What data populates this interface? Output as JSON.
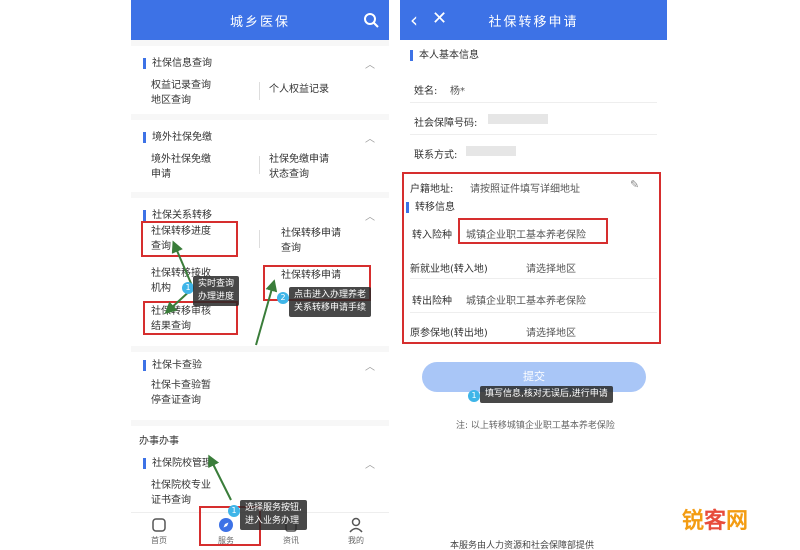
{
  "left": {
    "header_title": "城乡医保",
    "sections": [
      {
        "title": "社保信息查询",
        "items": [
          "权益记录查询\n地区查询",
          "个人权益记录"
        ]
      },
      {
        "title": "境外社保免缴",
        "items": [
          "境外社保免缴\n申请",
          "社保免缴申请\n状态查询"
        ]
      },
      {
        "title": "社保关系转移",
        "items": [
          "社保转移进度\n查询",
          "社保转移申请\n查询",
          "社保转移接收\n机构",
          "社保转移申请",
          "社保转移审核\n结果查询"
        ]
      },
      {
        "title": "社保卡查验",
        "items": [
          "社保卡查验暂\n停查证查询"
        ]
      },
      {
        "title": "社保院校管理",
        "items": [
          "社保院校专业\n证书查询"
        ]
      }
    ],
    "group_title": "办事办事",
    "tips": {
      "tip1": "实时查询\n办理进度",
      "tip2": "点击进入办理养老\n关系转移申请手续",
      "tip3": "选择服务按钮,\n进入业务办理"
    },
    "badges": [
      "1",
      "2",
      "1"
    ],
    "tabs": [
      "首页",
      "服务",
      "资讯",
      "我的"
    ]
  },
  "right": {
    "header_title": "社保转移申请",
    "basic_title": "本人基本信息",
    "name_label": "姓名:",
    "name_value": "杨*",
    "ssn_label": "社会保障号码:",
    "phone_label": "联系方式:",
    "address_label": "户籍地址:",
    "address_value": "请按照证件填写详细地址",
    "transfer_title": "转移信息",
    "in_type_label": "转入险种",
    "in_type_value": "城镇企业职工基本养老保险",
    "new_place_label": "新就业地(转入地)",
    "new_place_value": "请选择地区",
    "out_type_label": "转出险种",
    "out_type_value": "城镇企业职工基本养老保险",
    "orig_place_label": "原参保地(转出地)",
    "orig_place_value": "请选择地区",
    "submit_label": "提交",
    "tip": "填写信息,核对无误后,进行申请",
    "tip_badge": "1",
    "note": "注: 以上转移城镇企业职工基本养老保险",
    "footer": "本服务由人力资源和社会保障部提供"
  },
  "watermark": {
    "part1": "锐",
    "part2": "客",
    "part3": "网"
  }
}
